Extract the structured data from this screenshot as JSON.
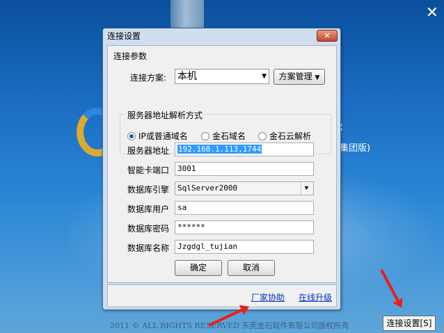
{
  "background": {
    "edition_text": "集团版)",
    "footer_text": "2011 ©  ALL RIGHTS RESERVED 东莞金石软件有限公司版权所有",
    "connect_button": "连接设置[S]",
    "close_glyph": "✕",
    "side_text": ":"
  },
  "dialog": {
    "title": "连接设置",
    "close_glyph": "✕",
    "section_title": "连接参数",
    "scheme_label": "连接方案:",
    "scheme_value": "本机",
    "scheme_manage_button": "方案管理",
    "resolve_group_title": "服务器地址解析方式",
    "radio_ip": "IP或普通域名",
    "radio_jinshi": "金石域名",
    "radio_cloud": "金石云解析",
    "fields": [
      {
        "label": "服务器地址",
        "value": "192.168.1.113,1744"
      },
      {
        "label": "智能卡端口",
        "value": "3001"
      },
      {
        "label": "数据库引擎",
        "value": "SqlServer2000"
      },
      {
        "label": "数据库用户",
        "value": "sa"
      },
      {
        "label": "数据库密码",
        "value": "******"
      },
      {
        "label": "数据库名称",
        "value": "Jzgdgl_tujian"
      }
    ],
    "ok_button": "确定",
    "cancel_button": "取消",
    "link_manufacturer": "厂家协助",
    "link_upgrade": "在线升级"
  },
  "colors": {
    "arrow": "#e8201a",
    "link": "#0033cc"
  }
}
